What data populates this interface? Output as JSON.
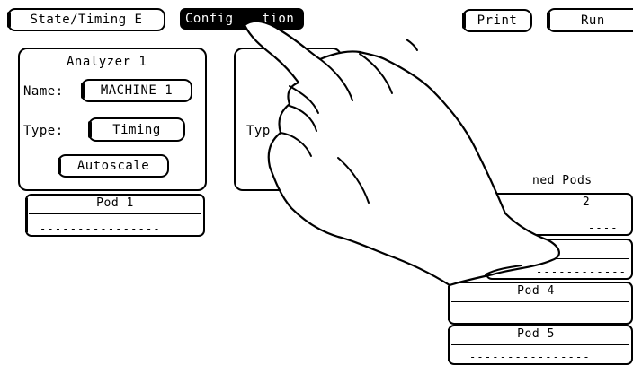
{
  "header": {
    "state_timing_label": "State/Timing E",
    "configuration_label_left": "Config",
    "configuration_label_right": "tion",
    "print_label": "Print",
    "run_label": "Run"
  },
  "analyzer1": {
    "title": "Analyzer 1",
    "name_label": "Name:",
    "name_value": "MACHINE 1",
    "type_label": "Type:",
    "type_value": "Timing",
    "autoscale_label": "Autoscale"
  },
  "analyzer2": {
    "type_label_partial": "Typ"
  },
  "pods_left": [
    {
      "label": "Pod 1",
      "value": "----------------"
    }
  ],
  "unassigned": {
    "title_partial": "ned Pods",
    "pods": [
      {
        "label": "2",
        "value": "----"
      },
      {
        "label": "",
        "value": "------------"
      },
      {
        "label": "Pod 4",
        "value": "----------------"
      },
      {
        "label": "Pod 5",
        "value": "----------------"
      }
    ]
  }
}
